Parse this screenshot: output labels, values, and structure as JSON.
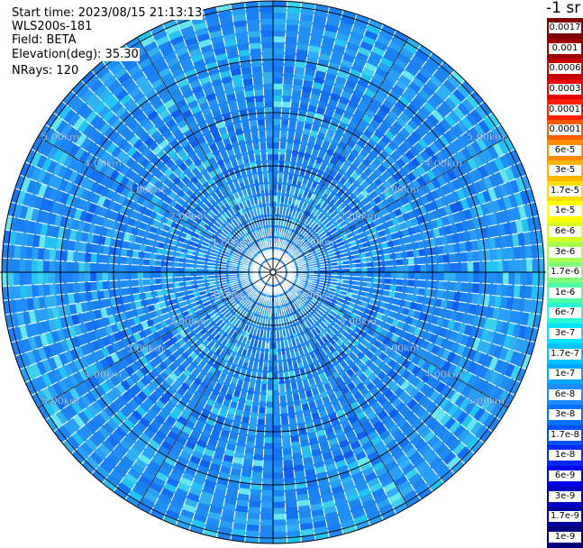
{
  "header": {
    "start_time": "Start time: 2023/08/15 21:13:13",
    "instrument": "WLS200s-181",
    "field": "Field: BETA",
    "elevation": "Elevation(deg): 35.30",
    "nrays": "NRays: 120"
  },
  "colorbar": {
    "title": "-1 sr",
    "labels": [
      "0.0017",
      "0.001",
      "0.0006",
      "0.0003",
      "0.00017",
      "0.0001",
      "6e-5",
      "3e-5",
      "1.7e-5",
      "1e-5",
      "6e-6",
      "3e-6",
      "1.7e-6",
      "1e-6",
      "6e-7",
      "3e-7",
      "1.7e-7",
      "1e-7",
      "6e-8",
      "3e-8",
      "1.7e-8",
      "1e-8",
      "6e-9",
      "3e-9",
      "1.7e-9",
      "1e-9"
    ],
    "colors": [
      "#7f0000",
      "#a00000",
      "#c40000",
      "#e60000",
      "#ff1e00",
      "#ff5a00",
      "#ff8c00",
      "#ffb400",
      "#ffdd00",
      "#ffff00",
      "#d8ff1e",
      "#a8ff4e",
      "#7dff7a",
      "#4effa8",
      "#28f8d4",
      "#00e4ff",
      "#00c4ff",
      "#00a8ff",
      "#1e8cff",
      "#0070ff",
      "#0050ff",
      "#0028ff",
      "#0000ee",
      "#0000c8",
      "#0000a0",
      "#00007f"
    ]
  },
  "range_labels": [
    "1.00km",
    "2.00km",
    "3.00km",
    "4.00km",
    "5.00km"
  ],
  "range_rings_km": [
    1,
    2,
    3,
    4,
    5
  ],
  "max_range_km": 5.1
}
